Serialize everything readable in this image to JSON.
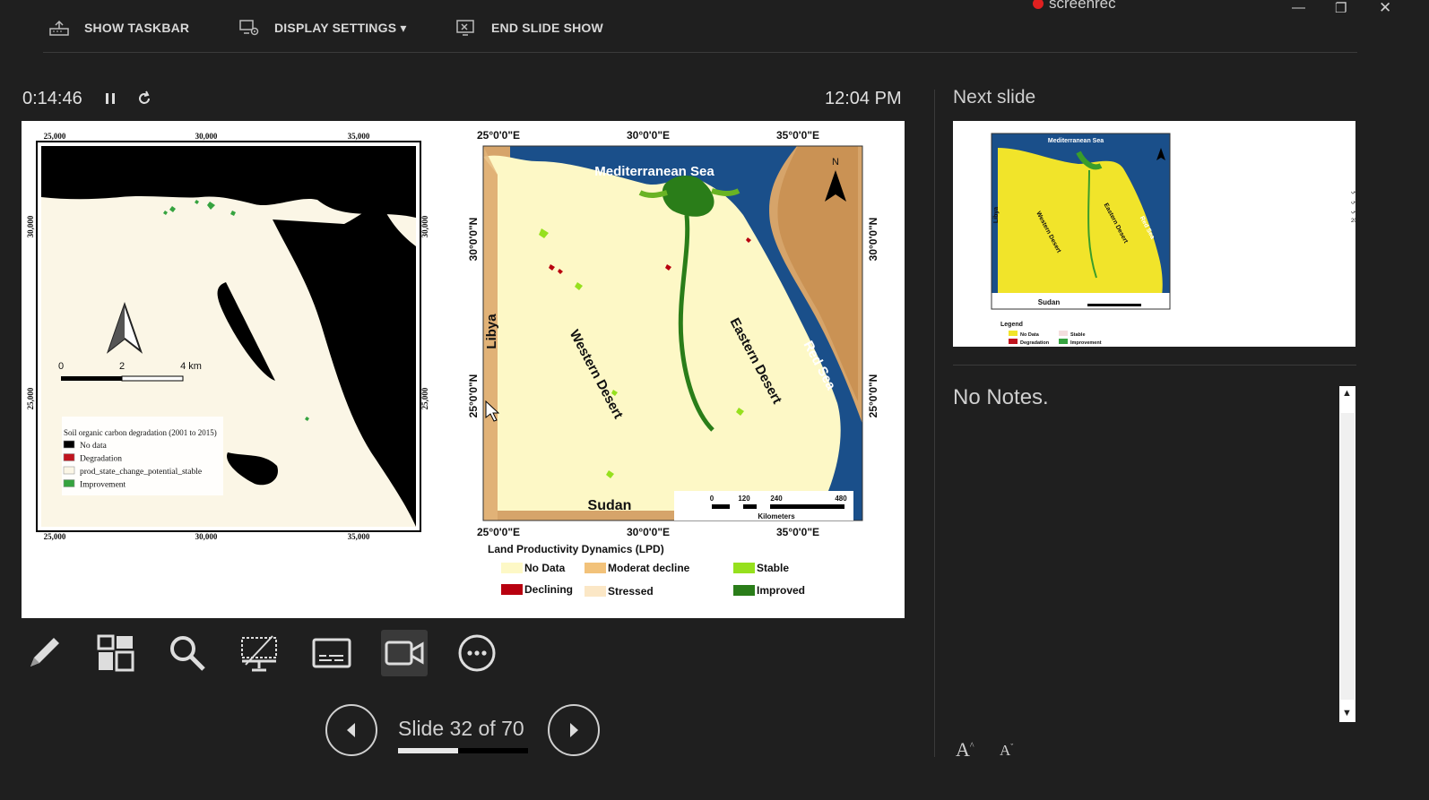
{
  "recorder": {
    "brand": "screenrec"
  },
  "topbar": {
    "show_taskbar": "SHOW TASKBAR",
    "display_settings": "DISPLAY SETTINGS ▾",
    "end_show": "END SLIDE SHOW"
  },
  "timer": {
    "elapsed": "0:14:46",
    "clock": "12:04 PM"
  },
  "next_slide": {
    "title": "Next slide",
    "arabic_text": "خريطة توضح التوزيع المكاني لمساحات الأراضي الخاصة بمياه تدهور التربة موضح عليها أماكن التحسن وأماكن التدهور ومناطق الثبات في الفترة من 2001 إلى 2015",
    "legend_title": "Legend",
    "legend": [
      "No Data",
      "Stable",
      "Degradation",
      "Improvement"
    ],
    "labels": {
      "sea": "Mediterranean Sea",
      "west": "Western Desert",
      "east": "Eastern Desert",
      "red": "Red Sea",
      "libya": "Libya",
      "sudan": "Sudan"
    }
  },
  "notes": {
    "text": "No Notes."
  },
  "slide_left": {
    "top_ticks": [
      "25,000",
      "30,000",
      "35,000"
    ],
    "bottom_ticks": [
      "25,000",
      "30,000",
      "35,000"
    ],
    "left_ticks": [
      "30,000",
      "25,000"
    ],
    "right_ticks": [
      "30,000",
      "25,000"
    ],
    "scale": {
      "a": "0",
      "b": "2",
      "c": "4 km"
    },
    "legend_title": "Soil organic carbon degradation (2001 to 2015)",
    "legend": [
      {
        "label": "No data",
        "color": "#000000"
      },
      {
        "label": "Degradation",
        "color": "#c0141e"
      },
      {
        "label": "prod_state_change_potential_stable",
        "color": "#fbf6e6"
      },
      {
        "label": "Improvement",
        "color": "#35a33f"
      }
    ]
  },
  "slide_right": {
    "top_ticks": [
      "25°0'0\"E",
      "30°0'0\"E",
      "35°0'0\"E"
    ],
    "bottom_ticks": [
      "25°0'0\"E",
      "30°0'0\"E",
      "35°0'0\"E"
    ],
    "lat_ticks": [
      "30°0'0\"N",
      "25°0'0\"N"
    ],
    "sea": "Mediterranean Sea",
    "west": "Western Desert",
    "east": "Eastern Desert",
    "red": "Red Sea",
    "libya": "Libya",
    "sudan": "Sudan",
    "north": "N",
    "scale": {
      "t0": "0",
      "t1": "120",
      "t2": "240",
      "t3": "480",
      "unit": "Kilometers"
    },
    "legend_title": "Land Productivity Dynamics (LPD)",
    "legend": [
      {
        "label": "No Data",
        "color": "#fdf8c6"
      },
      {
        "label": "Moderat decline",
        "color": "#f2c27a"
      },
      {
        "label": "Stable",
        "color": "#96e01e"
      },
      {
        "label": "Declining",
        "color": "#b8000f"
      },
      {
        "label": "Stressed",
        "color": "#fbe7c6"
      },
      {
        "label": "Improved",
        "color": "#2a7d19"
      }
    ]
  },
  "nav": {
    "slide_label": "Slide 32 of 70",
    "progress": 0.46
  },
  "font_controls": {
    "increase": "A",
    "decrease": "A"
  }
}
